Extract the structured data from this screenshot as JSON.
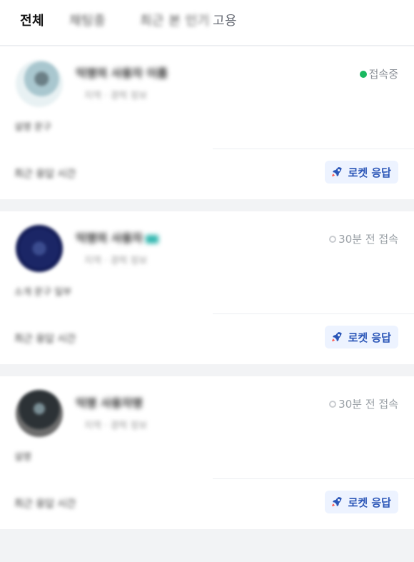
{
  "tabs": [
    {
      "label": "전체",
      "active": true
    },
    {
      "label": "채팅중"
    },
    {
      "label": "최근 본 인기"
    },
    {
      "label": "고용"
    }
  ],
  "cards": [
    {
      "name": "익명의 사용자 이름",
      "meta": "지역 · 경력 정보",
      "desc": "설명 문구",
      "status": "접속중",
      "online": true,
      "footer": "최근 응답 시간",
      "badge": "로켓 응답"
    },
    {
      "name": "익명의 사용자",
      "meta": "지역 · 경력 정보",
      "desc": "소개 문구 일부",
      "status": "30분 전 접속",
      "online": false,
      "footer": "최근 응답 시간",
      "badge": "로켓 응답"
    },
    {
      "name": "익명 사용자명",
      "meta": "지역 · 경력 정보",
      "desc": "설명",
      "status": "30분 전 접속",
      "online": false,
      "footer": "최근 응답 시간",
      "badge": "로켓 응답"
    }
  ],
  "colors": {
    "accent": "#2a55b7",
    "badge_bg": "#edf3ff",
    "online": "#19b860"
  },
  "icons": {
    "rocket": "rocket-icon",
    "status_online": "online-dot-icon",
    "status_offline": "offline-dot-icon"
  }
}
